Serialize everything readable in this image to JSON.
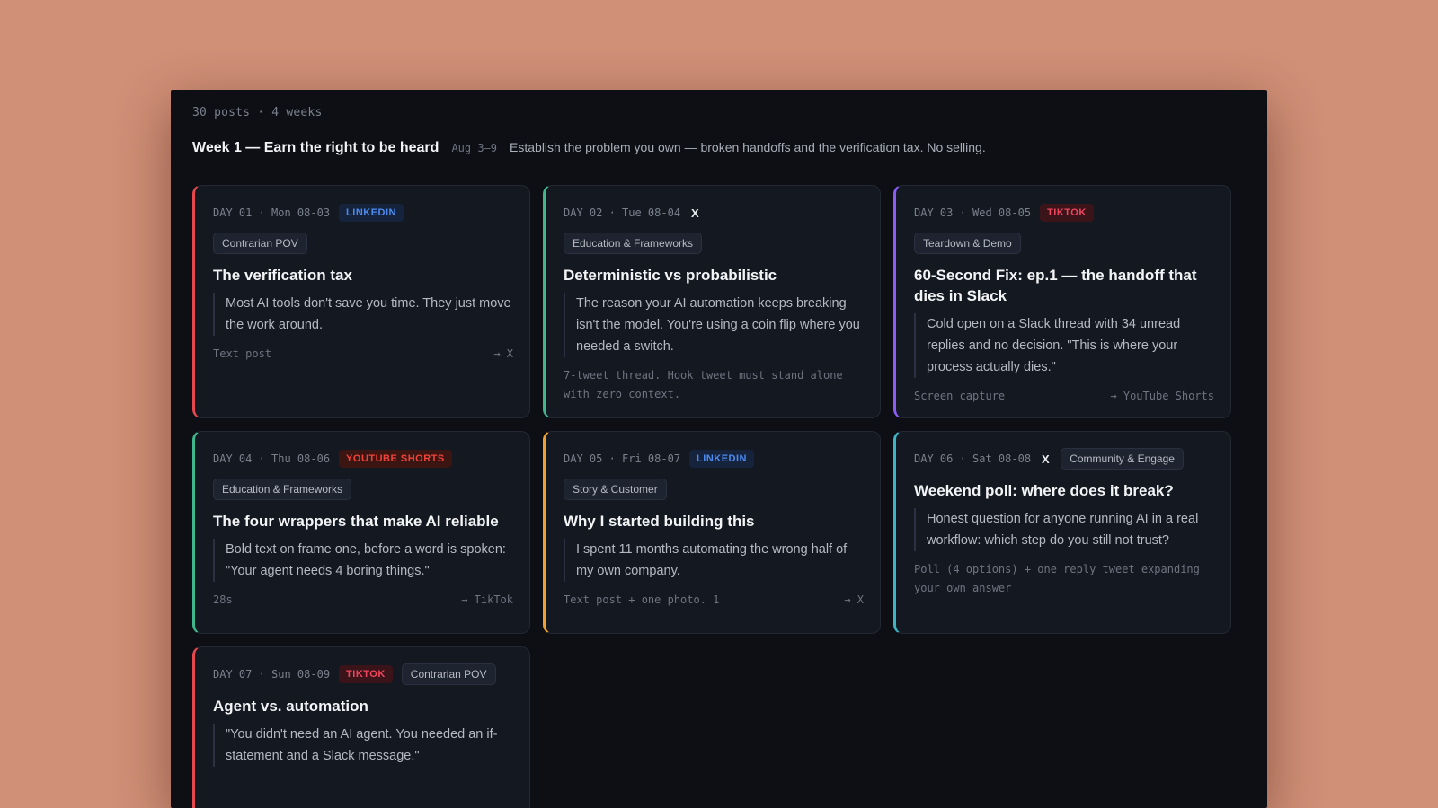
{
  "meta": "30 posts · 4 weeks",
  "week": {
    "title": "Week 1 — Earn the right to be heard",
    "dates": "Aug 3–9",
    "description": "Establish the problem you own — broken handoffs and the verification tax. No selling."
  },
  "colors": {
    "background": "#d08f77",
    "panel": "#0d0f14",
    "card": "#141821",
    "linkedin": "#4c8bf0",
    "tiktok": "#f0455e",
    "youtube_shorts": "#f0443a"
  },
  "cards": [
    {
      "day": "DAY 01 · Mon 08-03",
      "platform": "LINKEDIN",
      "tag": "Contrarian POV",
      "title": "The verification tax",
      "quote": "Most AI tools don't save you time. They just move the work around.",
      "format": "Text post",
      "crosspost": "→ X",
      "accent": "#e5484d"
    },
    {
      "day": "DAY 02 · Tue 08-04",
      "platform": "X",
      "tag": "Education & Frameworks",
      "title": "Deterministic vs probabilistic",
      "quote": "The reason your AI automation keeps breaking isn't the model. You're using a coin flip where you needed a switch.",
      "format": "7-tweet thread. Hook tweet must stand alone with zero context.",
      "crosspost": "",
      "accent": "#3fb68b"
    },
    {
      "day": "DAY 03 · Wed 08-05",
      "platform": "TIKTOK",
      "tag": "Teardown & Demo",
      "title": "60-Second Fix: ep.1 — the handoff that dies in Slack",
      "quote": "Cold open on a Slack thread with 34 unread replies and no decision. \"This is where your process actually dies.\"",
      "format": "Screen capture",
      "crosspost": "→ YouTube Shorts",
      "accent": "#8b5cf6"
    },
    {
      "day": "DAY 04 · Thu 08-06",
      "platform": "YOUTUBE SHORTS",
      "tag": "Education & Frameworks",
      "title": "The four wrappers that make AI reliable",
      "quote": "Bold text on frame one, before a word is spoken: \"Your agent needs 4 boring things.\"",
      "format": "28s",
      "crosspost": "→ TikTok",
      "accent": "#3fb68b"
    },
    {
      "day": "DAY 05 · Fri 08-07",
      "platform": "LINKEDIN",
      "tag": "Story & Customer",
      "title": "Why I started building this",
      "quote": "I spent 11 months automating the wrong half of my own company.",
      "format": "Text post + one photo. 1",
      "crosspost": "→ X",
      "accent": "#f0a030"
    },
    {
      "day": "DAY 06 · Sat 08-08",
      "platform": "X",
      "tag": "Community & Engage",
      "title": "Weekend poll: where does it break?",
      "quote": "Honest question for anyone running AI in a real workflow: which step do you still not trust?",
      "format": "Poll (4 options) + one reply tweet expanding your own answer",
      "crosspost": "",
      "accent": "#3cb4c4"
    },
    {
      "day": "DAY 07 · Sun 08-09",
      "platform": "TIKTOK",
      "tag": "Contrarian POV",
      "title": "Agent vs. automation",
      "quote": "\"You didn't need an AI agent. You needed an if-statement and a Slack message.\"",
      "format": "",
      "crosspost": "",
      "accent": "#e5484d"
    }
  ]
}
